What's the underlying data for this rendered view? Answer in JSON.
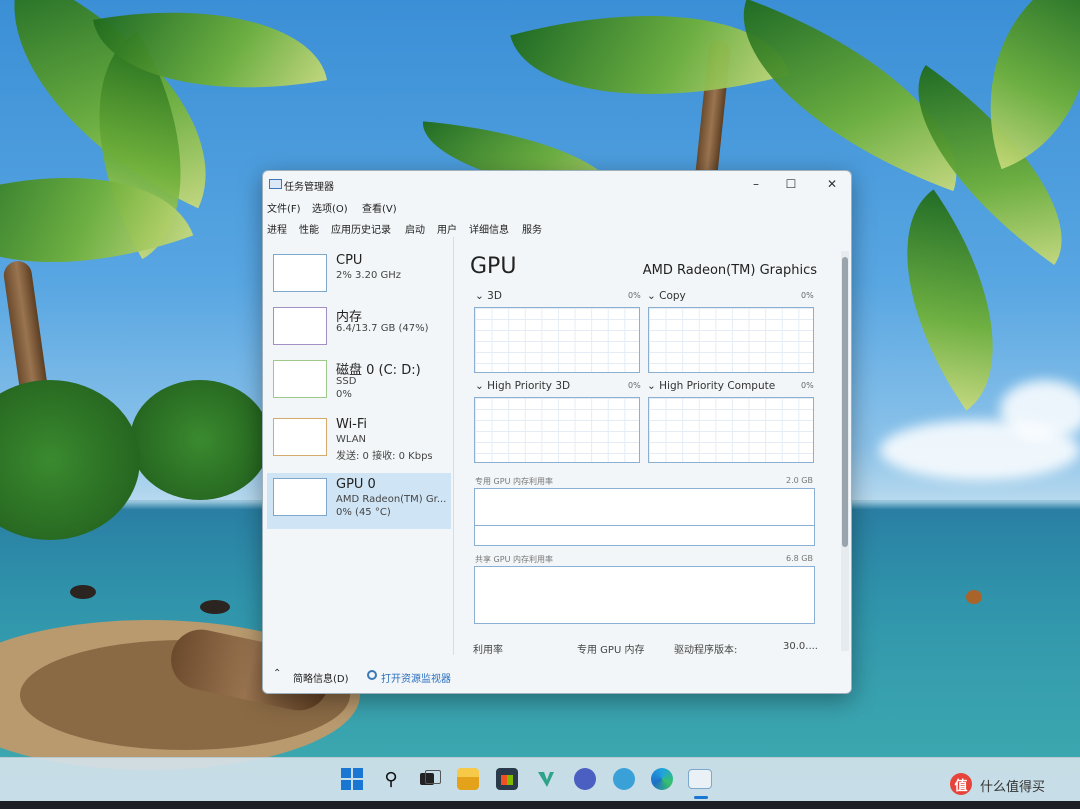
{
  "window": {
    "title": "任务管理器",
    "controls": {
      "minimize": "–",
      "maximize": "☐",
      "close": "✕"
    }
  },
  "menu": [
    "文件(F)",
    "选项(O)",
    "查看(V)"
  ],
  "tabs": [
    "进程",
    "性能",
    "应用历史记录",
    "启动",
    "用户",
    "详细信息",
    "服务"
  ],
  "sidebar": {
    "items": [
      {
        "name": "CPU",
        "line1": "2%  3.20 GHz",
        "line2": ""
      },
      {
        "name": "内存",
        "line1": "6.4/13.7 GB (47%)",
        "line2": ""
      },
      {
        "name": "磁盘 0 (C: D:)",
        "line1": "SSD",
        "line2": "0%"
      },
      {
        "name": "Wi-Fi",
        "line1": "WLAN",
        "line2": "发送: 0  接收: 0 Kbps"
      },
      {
        "name": "GPU 0",
        "line1": "AMD Radeon(TM) Gr...",
        "line2": "0%  (45 °C)"
      }
    ]
  },
  "main": {
    "title": "GPU",
    "model": "AMD Radeon(TM) Graphics",
    "graphs": [
      {
        "label": "3D",
        "pct": "0%"
      },
      {
        "label": "Copy",
        "pct": "0%"
      },
      {
        "label": "High Priority 3D",
        "pct": "0%"
      },
      {
        "label": "High Priority Compute",
        "pct": "0%"
      }
    ],
    "dedicated_mem": {
      "label": "专用 GPU 内存利用率",
      "value": "2.0 GB"
    },
    "shared_mem": {
      "label": "共享 GPU 内存利用率",
      "value": "6.8 GB"
    },
    "footer": {
      "util": "利用率",
      "dedicated": "专用 GPU 内存",
      "driver": "驱动程序版本:",
      "driver_value": "30.0...."
    }
  },
  "statusbar": {
    "fewer_details": "简略信息(D)",
    "resource_monitor": "打开资源监视器"
  },
  "taskbar": {
    "icons": [
      "start-icon",
      "search-icon",
      "task-view-icon",
      "file-explorer-icon",
      "store-icon",
      "app-icon",
      "app-icon",
      "app-icon",
      "edge-icon",
      "task-manager-icon"
    ]
  },
  "watermark": {
    "badge": "值",
    "text": "什么值得买"
  }
}
